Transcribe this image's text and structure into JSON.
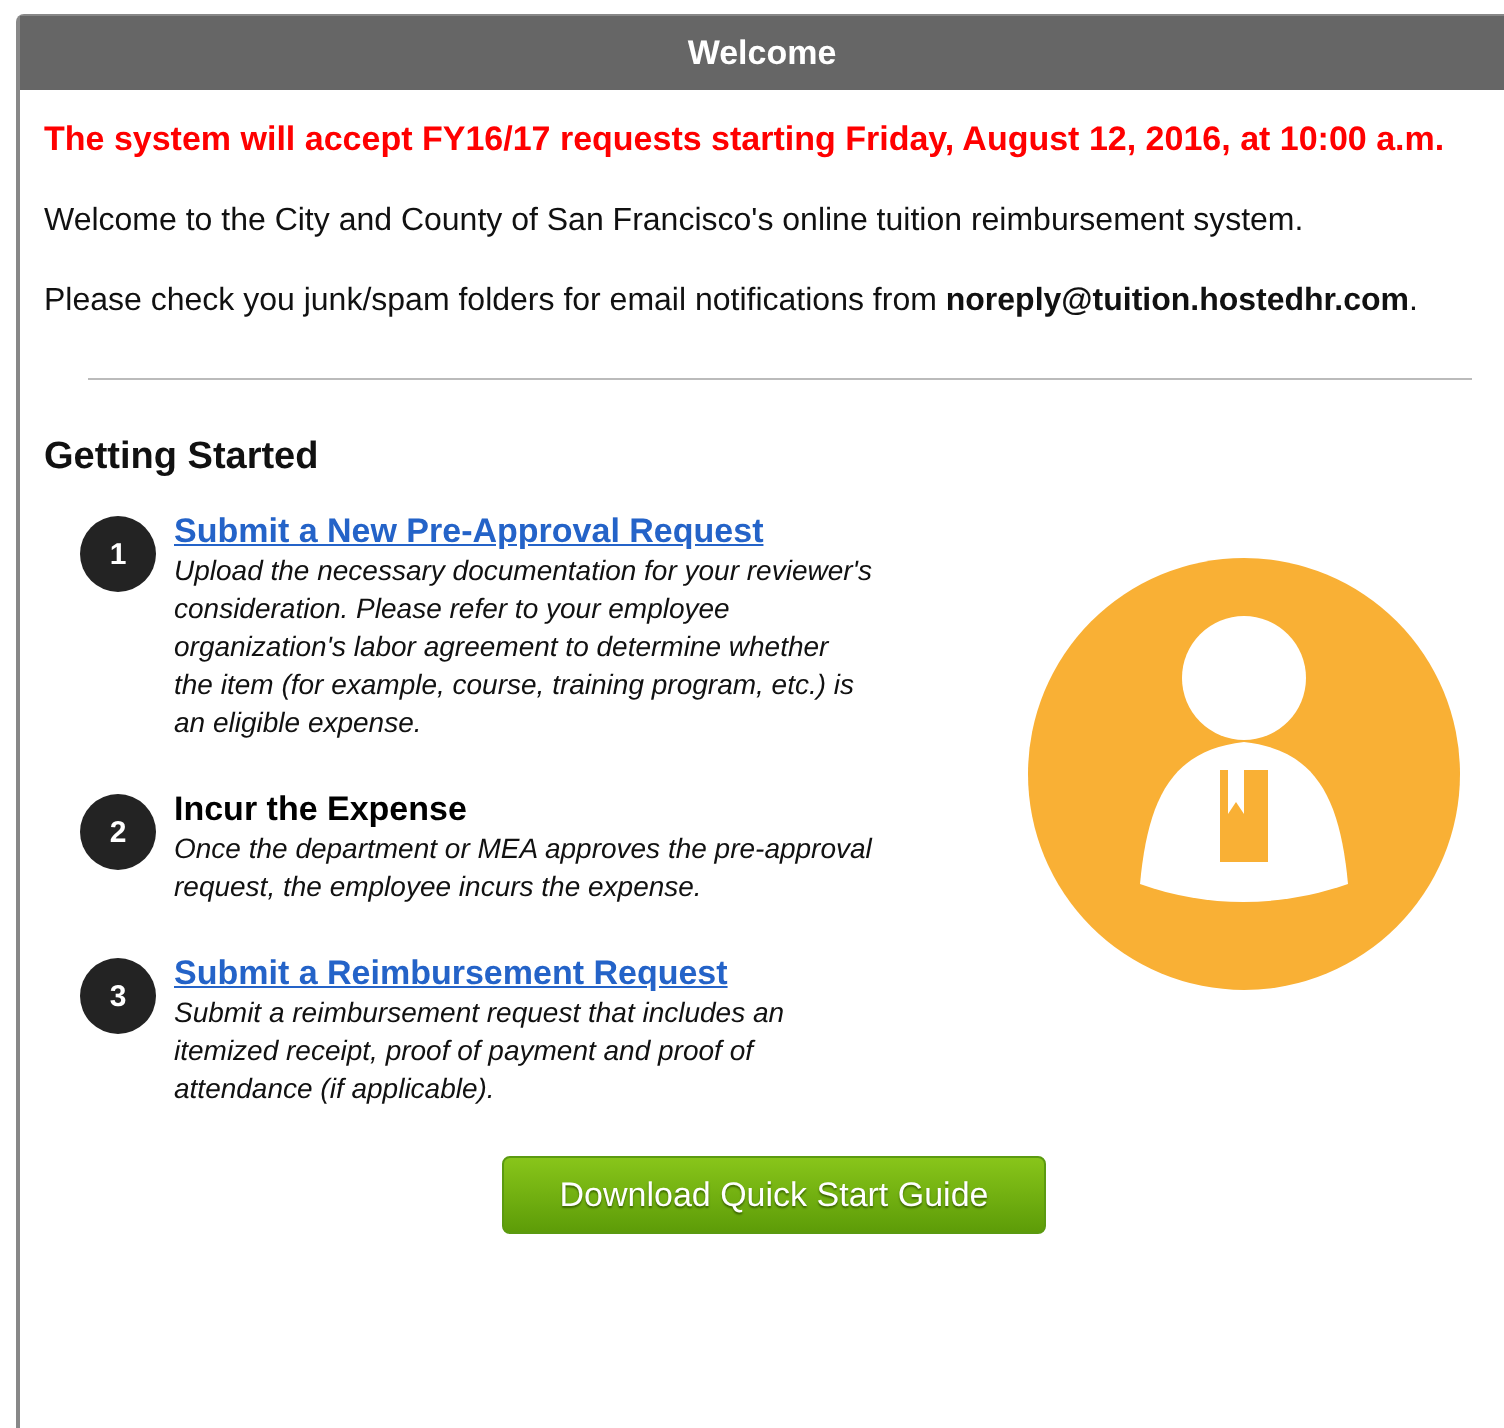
{
  "panel": {
    "title": "Welcome"
  },
  "notice": "The system will accept FY16/17 requests starting Friday, August 12, 2016, at 10:00 a.m.",
  "intro": "Welcome to the City and County of San Francisco's online tuition reimbursement system.",
  "email_note": "Please check you junk/spam folders for email notifications from **noreply@tuition.hostedhr.com**.",
  "getting_started": {
    "heading": "Getting Started",
    "steps": [
      {
        "number": "1",
        "kind": "link",
        "title": "Submit a New Pre-Approval Request",
        "description": "Upload the necessary documentation for your reviewer's consideration. Please refer to your employee organization's labor agreement to determine whether the item (for example, course, training program, etc.) is an eligible expense."
      },
      {
        "number": "2",
        "kind": "heading",
        "title": "Incur the Expense",
        "description": "Once the department or MEA approves the pre-approval request, the employee incurs the expense."
      },
      {
        "number": "3",
        "kind": "link",
        "title": "Submit a Reimbursement Request",
        "description": "Submit a reimbursement request that includes an itemized receipt, proof of payment and proof of attendance (if applicable)."
      }
    ]
  },
  "button": "Download Quick Start Guide"
}
